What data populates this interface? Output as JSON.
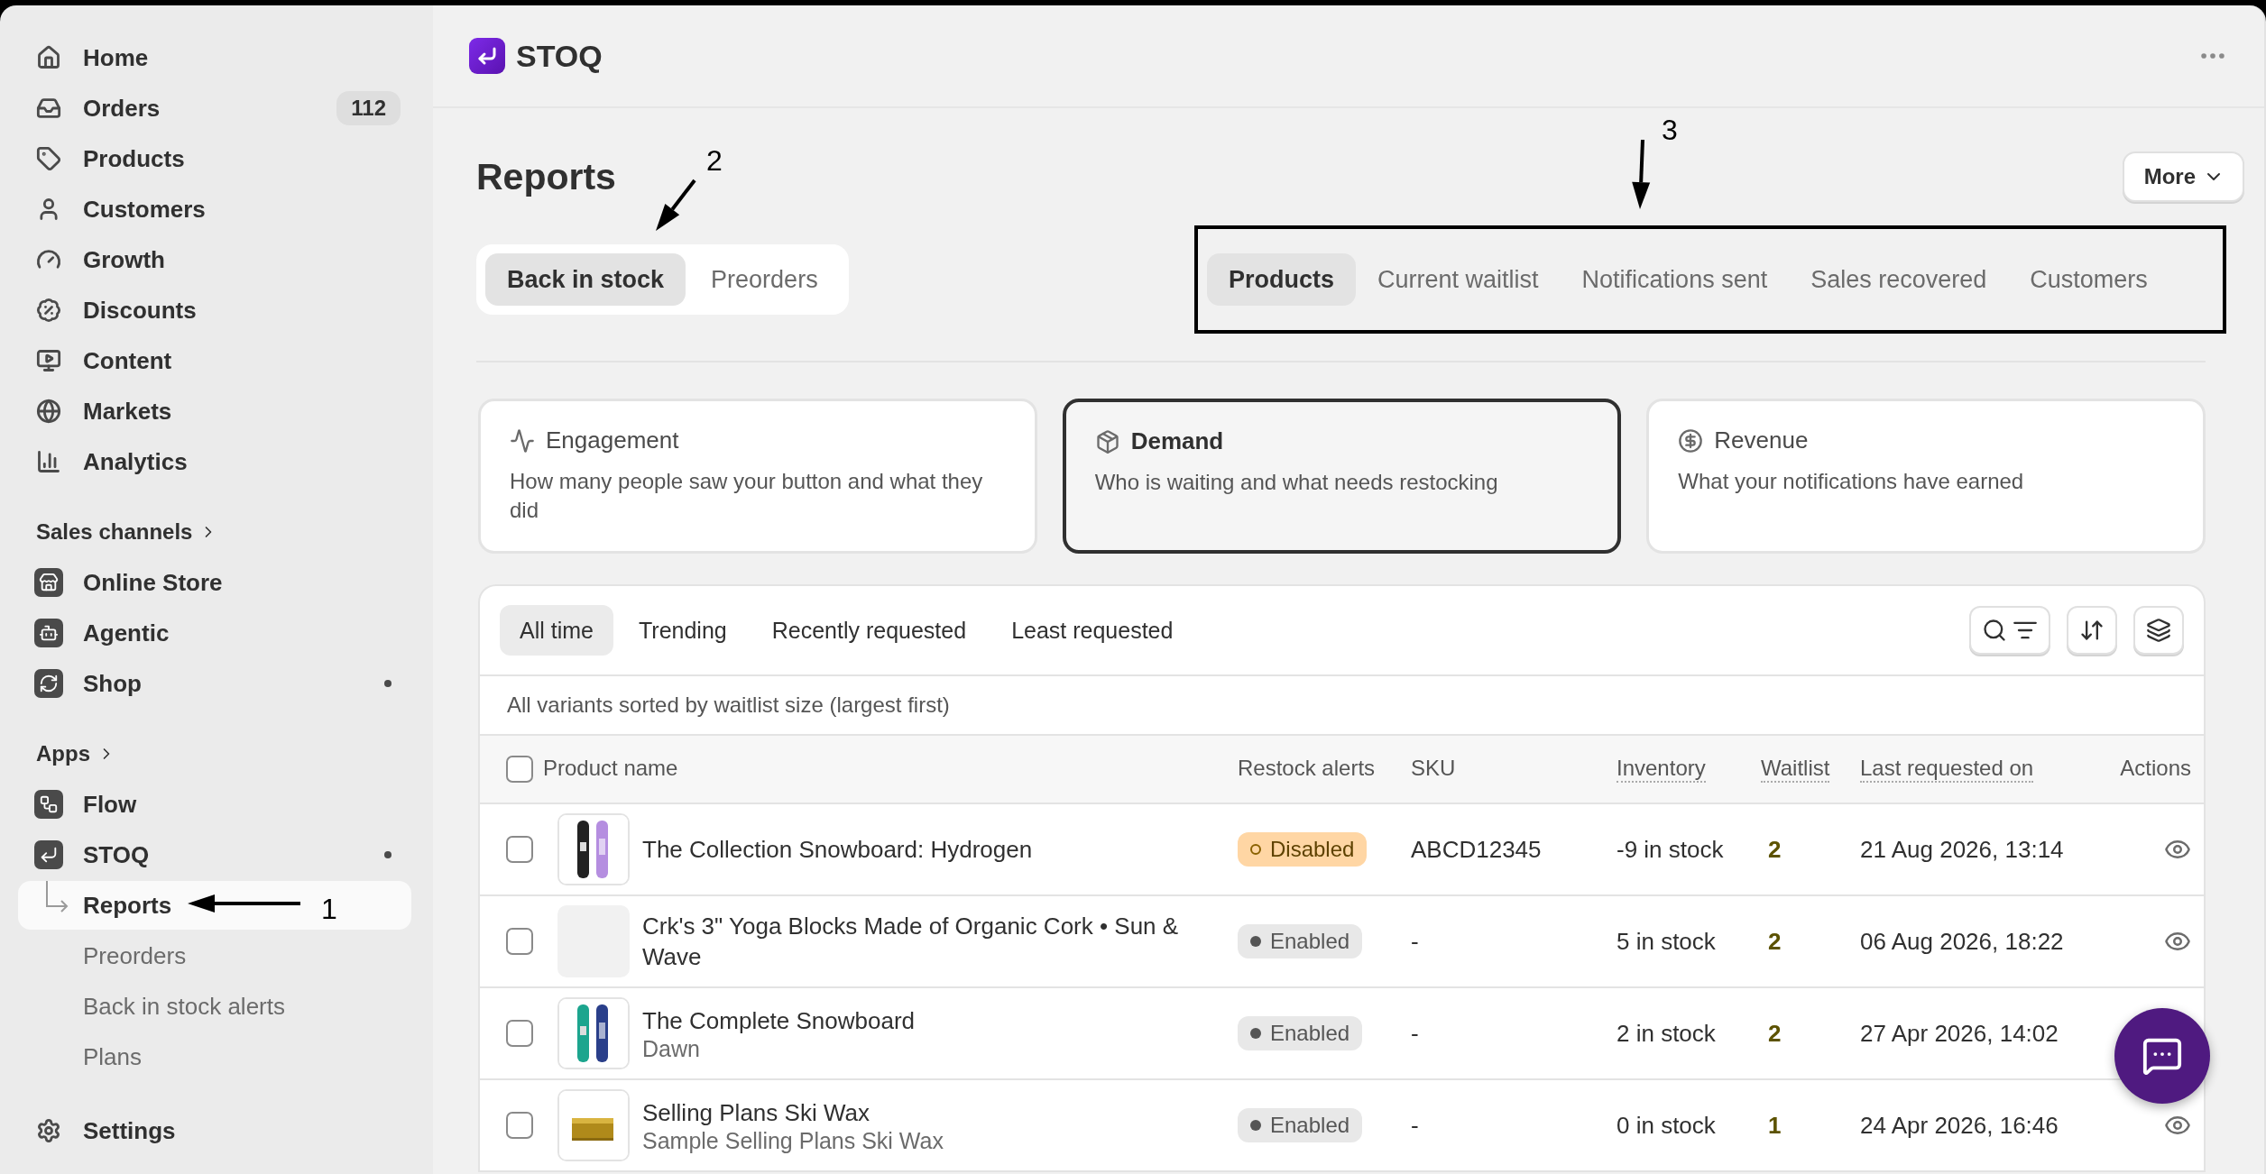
{
  "sidebar": {
    "items": [
      {
        "label": "Home",
        "selected": false
      },
      {
        "label": "Orders",
        "badge": "112",
        "selected": false
      },
      {
        "label": "Products",
        "selected": false
      },
      {
        "label": "Customers",
        "selected": false
      },
      {
        "label": "Growth",
        "selected": false
      },
      {
        "label": "Discounts",
        "selected": false
      },
      {
        "label": "Content",
        "selected": false
      },
      {
        "label": "Markets",
        "selected": false
      },
      {
        "label": "Analytics",
        "selected": false
      }
    ],
    "sales_channels": {
      "title": "Sales channels",
      "items": [
        {
          "label": "Online Store",
          "dot": false
        },
        {
          "label": "Agentic",
          "dot": false
        },
        {
          "label": "Shop",
          "dot": true
        }
      ]
    },
    "apps": {
      "title": "Apps",
      "items": [
        {
          "label": "Flow",
          "dot": false
        },
        {
          "label": "STOQ",
          "dot": true,
          "children": [
            {
              "label": "Reports",
              "selected": true
            },
            {
              "label": "Preorders",
              "selected": false
            },
            {
              "label": "Back in stock alerts",
              "selected": false
            },
            {
              "label": "Plans",
              "selected": false
            }
          ]
        }
      ]
    },
    "settings": "Settings"
  },
  "app_header": {
    "name": "STOQ"
  },
  "page": {
    "title": "Reports",
    "more_button": "More",
    "segments": [
      {
        "label": "Back in stock",
        "selected": true
      },
      {
        "label": "Preorders",
        "selected": false
      }
    ],
    "tabs_highlighted": true,
    "tabs": [
      {
        "label": "Products",
        "selected": true
      },
      {
        "label": "Current waitlist",
        "selected": false
      },
      {
        "label": "Notifications sent",
        "selected": false
      },
      {
        "label": "Sales recovered",
        "selected": false
      },
      {
        "label": "Customers",
        "selected": false
      }
    ],
    "cards": [
      {
        "title": "Engagement",
        "description": "How many people saw your button and what they did",
        "selected": false
      },
      {
        "title": "Demand",
        "description": "Who is waiting and what needs restocking",
        "selected": true
      },
      {
        "title": "Revenue",
        "description": "What your notifications have earned",
        "selected": false
      }
    ]
  },
  "table": {
    "filters": [
      {
        "label": "All time",
        "selected": true
      },
      {
        "label": "Trending",
        "selected": false
      },
      {
        "label": "Recently requested",
        "selected": false
      },
      {
        "label": "Least requested",
        "selected": false
      }
    ],
    "caption": "All variants sorted by waitlist size (largest first)",
    "select_all_checked": false,
    "columns": [
      {
        "label": "Product name",
        "underlined": false
      },
      {
        "label": "Restock alerts",
        "underlined": false
      },
      {
        "label": "SKU",
        "underlined": false
      },
      {
        "label": "Inventory",
        "underlined": true
      },
      {
        "label": "Waitlist",
        "underlined": true
      },
      {
        "label": "Last requested on",
        "underlined": true
      },
      {
        "label": "Actions",
        "underlined": false
      }
    ],
    "rows": [
      {
        "checked": false,
        "name": "The Collection Snowboard: Hydrogen",
        "status": {
          "label": "Disabled",
          "kind": "disabled"
        },
        "sku": "ABCD12345",
        "inventory": "-9 in stock",
        "waitlist": "2",
        "last_requested": "21 Aug 2026, 13:14"
      },
      {
        "checked": false,
        "thumbnail": {
          "kind": "empty"
        },
        "name": "Crk's 3\" Yoga Blocks Made of Organic Cork • Sun & Wave",
        "status": {
          "label": "Enabled",
          "kind": "enabled"
        },
        "sku": "-",
        "inventory": "5 in stock",
        "waitlist": "2",
        "last_requested": "06 Aug 2026, 18:22"
      },
      {
        "checked": false,
        "name": "The Complete Snowboard",
        "variant": "Dawn",
        "status": {
          "label": "Enabled",
          "kind": "enabled"
        },
        "sku": "-",
        "inventory": "2 in stock",
        "waitlist": "2",
        "last_requested": "27 Apr 2026, 14:02"
      },
      {
        "checked": false,
        "name": "Selling Plans Ski Wax",
        "variant": "Sample Selling Plans Ski Wax",
        "status": {
          "label": "Enabled",
          "kind": "enabled"
        },
        "sku": "-",
        "inventory": "0 in stock",
        "waitlist": "1",
        "last_requested": "24 Apr 2026, 16:46"
      }
    ]
  },
  "annotations": [
    {
      "label": "1"
    },
    {
      "label": "2"
    },
    {
      "label": "3"
    }
  ]
}
